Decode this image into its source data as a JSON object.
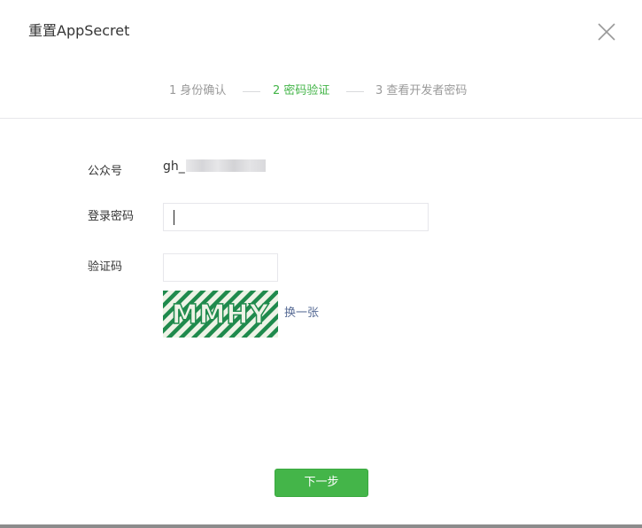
{
  "dialog": {
    "title": "重置AppSecret",
    "close_icon": "close-icon"
  },
  "steps": [
    {
      "label": "1 身份确认",
      "state": "done"
    },
    {
      "label": "2 密码验证",
      "state": "active"
    },
    {
      "label": "3 查看开发者密码",
      "state": "pending"
    }
  ],
  "form": {
    "account_label": "公众号",
    "account_value_prefix": "gh_",
    "password_label": "登录密码",
    "password_value": "",
    "captcha_label": "验证码",
    "captcha_value": "",
    "captcha_text": "MMHY",
    "refresh_label": "换一张"
  },
  "actions": {
    "next_label": "下一步"
  },
  "colors": {
    "accent": "#44b549",
    "link": "#576b95",
    "step_inactive": "#9a9a9a",
    "captcha_green": "#1f8a4c"
  }
}
